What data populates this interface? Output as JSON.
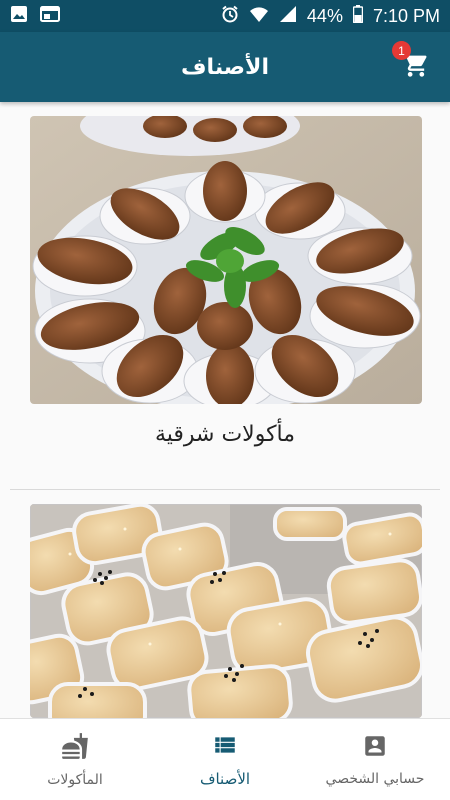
{
  "status_bar": {
    "battery": "44%",
    "time": "7:10 PM"
  },
  "app_bar": {
    "title": "الأصناف",
    "cart_badge": "1"
  },
  "categories": [
    {
      "title": "مأكولات شرقية"
    },
    {
      "title": ""
    }
  ],
  "bottom_nav": {
    "items": [
      {
        "label": "حسابي الشخصي",
        "icon": "account-box-icon"
      },
      {
        "label": "الأصناف",
        "icon": "categories-list-icon"
      },
      {
        "label": "المأكولات",
        "icon": "food-icon"
      }
    ]
  },
  "colors": {
    "primary": "#165b73",
    "status_bar": "#0f4e65",
    "badge": "#e53935"
  }
}
